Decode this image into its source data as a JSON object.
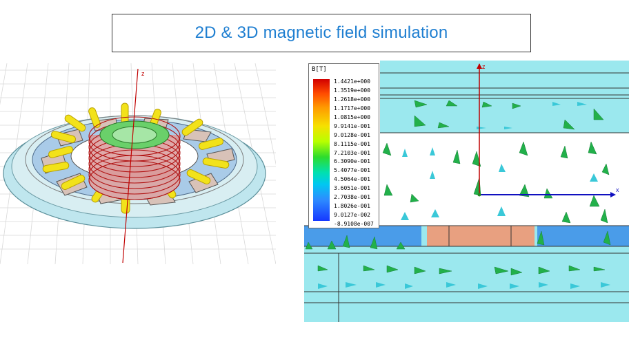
{
  "title": "2D & 3D magnetic field simulation",
  "legend": {
    "title": "B[T]",
    "labels": [
      "1.4421e+000",
      "1.3519e+000",
      "1.2618e+000",
      "1.1717e+000",
      "1.0815e+000",
      "9.9141e-001",
      "9.0128e-001",
      "8.1115e-001",
      "7.2103e-001",
      "6.3090e-001",
      "5.4077e-001",
      "4.5064e-001",
      "3.6051e-001",
      "2.7038e-001",
      "1.8026e-001",
      "9.0127e-002",
      "-8.9108e-007"
    ]
  },
  "axes": {
    "z_3d": "z",
    "z_2d": "z",
    "x_2d": "x"
  },
  "colors": {
    "title": "#1f7fd1",
    "field_arrow": "#22b04a",
    "coil": "#f0e020",
    "magnet": "#e8a080"
  }
}
